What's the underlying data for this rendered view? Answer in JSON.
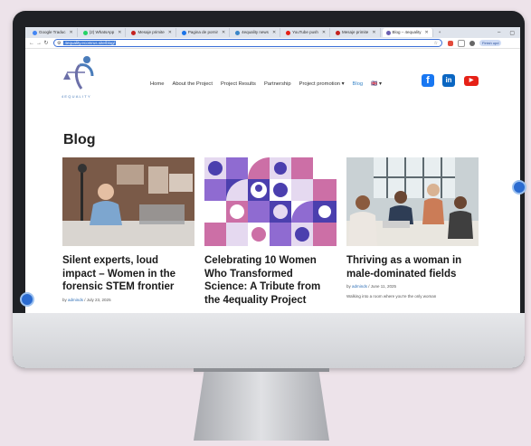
{
  "browser": {
    "tabs": [
      {
        "label": "Google Traduc",
        "color": "#4285f4"
      },
      {
        "label": "(2) WhatsApp",
        "color": "#25d366"
      },
      {
        "label": "Mesaje primite",
        "color": "#c5221f"
      },
      {
        "label": "Pagina de pornir",
        "color": "#1a73e8"
      },
      {
        "label": "4equality news",
        "color": "#3a86c8"
      },
      {
        "label": "YouTube push",
        "color": "#e62117"
      },
      {
        "label": "Mesaje primite",
        "color": "#c5221f"
      },
      {
        "label": "Blog – 4equality",
        "color": "#6b5fb0",
        "active": true
      }
    ],
    "url": "4equality.ecomrus.site/blog/",
    "finish_label": "Finish upd"
  },
  "site": {
    "logo_text": "4EQUALITY",
    "nav": [
      "Home",
      "About the Project",
      "Project Results",
      "Partnership",
      "Project promotion ▾",
      "Blog",
      "🇬🇧 ▾"
    ],
    "social_icons": [
      "facebook-icon",
      "linkedin-icon",
      "youtube-icon"
    ]
  },
  "blog": {
    "title": "Blog",
    "posts": [
      {
        "title": "Silent experts, loud impact – Women in the forensic STEM frontier",
        "author": "adminds",
        "date": "July 23, 2025"
      },
      {
        "title": "Celebrating 10 Women Who Transformed Science: A Tribute from the 4equality Project",
        "author": "",
        "date": ""
      },
      {
        "title": "Thriving as a woman in male-dominated fields",
        "author": "adminds",
        "date": "June 11, 2025",
        "excerpt": "Walking into a room where you're the only woman"
      }
    ]
  },
  "colors": {
    "accent": "#3a86c8",
    "monitor_bg": "#ede3ea"
  }
}
